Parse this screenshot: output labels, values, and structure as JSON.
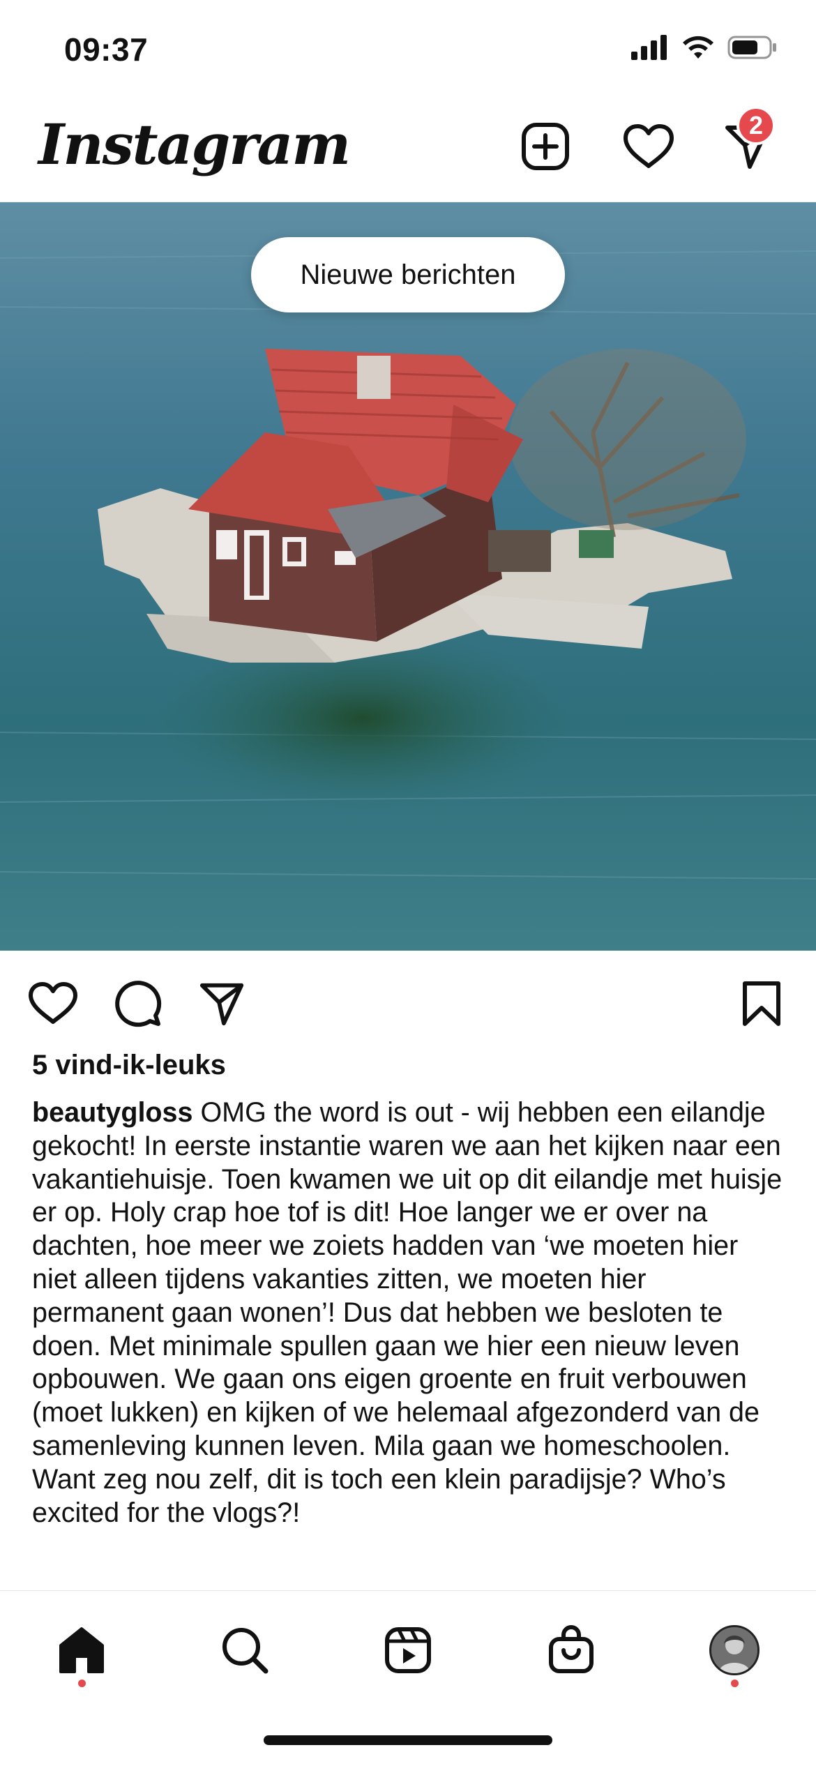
{
  "status_bar": {
    "time": "09:37"
  },
  "header": {
    "logo": "Instagram",
    "messages_badge": "2",
    "icons": [
      "plus-square-icon",
      "heart-icon",
      "direct-send-icon"
    ]
  },
  "post": {
    "image_subject": "aerial photo of small island with red-roof house",
    "new_posts_label": "Nieuwe berichten",
    "likes": "5 vind-ik-leuks",
    "username": "beautygloss",
    "caption": " OMG the word is out - wij hebben een eilandje gekocht! In eerste instantie waren we aan het kijken naar een vakantiehuisje. Toen kwamen we uit op dit eilandje met huisje er op. Holy crap hoe tof is dit! Hoe langer we er over na dachten, hoe meer we zoiets hadden van ‘we moeten hier niet alleen tijdens vakanties zitten, we moeten hier permanent gaan wonen’! Dus dat hebben we besloten te doen. Met minimale spullen gaan we hier een nieuw leven opbouwen. We gaan ons eigen groente en fruit verbouwen (moet lukken) en kijken of we helemaal afgezonderd van de samenleving kunnen leven. Mila gaan we homeschoolen. Want zeg nou zelf, dit is toch een klein paradijsje? Who’s excited for the vlogs?!",
    "action_icons": [
      "heart-icon",
      "comment-icon",
      "share-icon",
      "bookmark-icon"
    ]
  },
  "bottom_nav": {
    "items": [
      "home-icon",
      "search-icon",
      "reels-icon",
      "shop-icon",
      "profile-avatar"
    ],
    "accent": "#e5484d"
  }
}
